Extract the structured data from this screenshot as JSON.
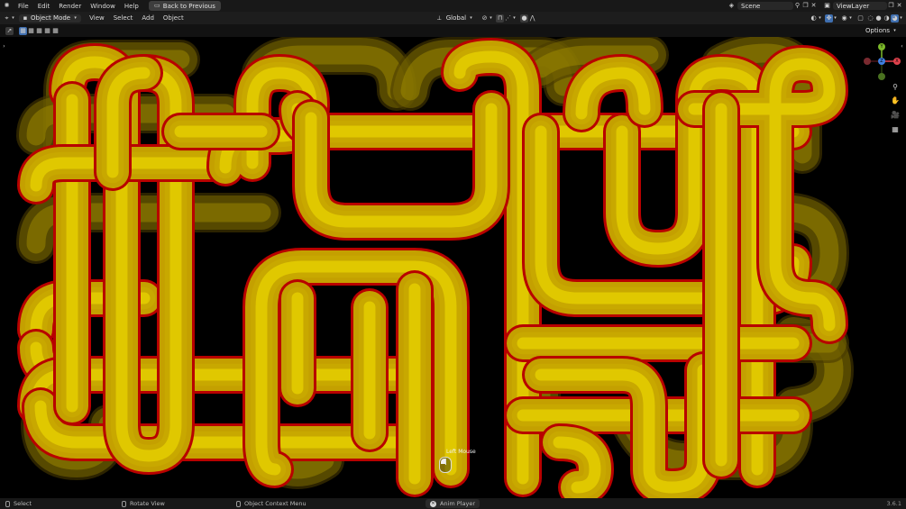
{
  "topbar": {
    "menu": [
      "File",
      "Edit",
      "Render",
      "Window",
      "Help"
    ],
    "back_button": "Back to Previous",
    "scene_name": "Scene",
    "view_layer": "ViewLayer"
  },
  "header": {
    "mode": "Object Mode",
    "menus": [
      "View",
      "Select",
      "Add",
      "Object"
    ],
    "transform_orientation": "Global",
    "options_label": "Options"
  },
  "gizmo": {
    "x": "X",
    "y": "Y",
    "z": "Z"
  },
  "overlay_hint": "Left Mouse",
  "statusbar": {
    "select": "Select",
    "rotate": "Rotate View",
    "context": "Object Context Menu",
    "anim": "Anim Player",
    "version": "3.6.1"
  },
  "colors": {
    "pipe_inner": "#e0c800",
    "pipe_mid": "#c8a800",
    "pipe_edge": "#b80000",
    "gizmo_x": "#e0414c",
    "gizmo_y": "#7cba2a",
    "gizmo_z": "#3f7fe0"
  }
}
